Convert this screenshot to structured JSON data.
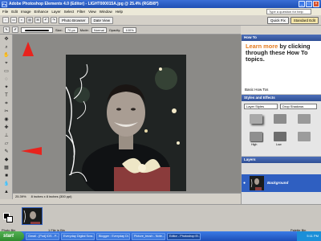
{
  "window": {
    "title": "Adobe Photoshop Elements 4.0 (Editor) - LIGHT000015A.jpg @ 25.4% (RGB/8*)",
    "app_icon_label": "Ps"
  },
  "menubar": {
    "items": [
      "File",
      "Edit",
      "Image",
      "Enhance",
      "Layer",
      "Select",
      "Filter",
      "View",
      "Window",
      "Help"
    ],
    "help_search_placeholder": "Type a question for help"
  },
  "shortcuts": {
    "photo_browser": "Photo Browser",
    "date_view": "Date View",
    "quick_fix": "Quick Fix",
    "standard_edit": "Standard Edit"
  },
  "options": {
    "size_label": "Size:",
    "size_value": "70 px",
    "mode_label": "Mode:",
    "mode_value": "Normal",
    "opacity_label": "Opacity:",
    "opacity_value": "100%"
  },
  "document": {
    "zoom": "25.39%",
    "dimensions": "8 inches x 8 inches (300 ppi)"
  },
  "panels": {
    "howto": {
      "title": "How To",
      "learn_prefix": "Learn more",
      "learn_rest": " by clicking through these How To topics.",
      "basic": "Basic How Tos"
    },
    "styles": {
      "title": "Styles and Effects",
      "category": "Layer Styles",
      "subcategory": "Drop Shadows",
      "swatch_labels": [
        "High",
        "Low"
      ]
    },
    "layers": {
      "title": "Layers",
      "layer_name": "Background"
    }
  },
  "photobin": {
    "label": "Photo Bin",
    "counter": "1 File in Bin",
    "palette_bin": "Palette Bin"
  },
  "taskbar": {
    "start": "start",
    "tasks": [
      "Gmail - [Pod] IDS - P...",
      "Everyday Digital Scra...",
      "Blogger : Everyday Di...",
      "Picture_brush - Note...",
      "Editor - Photoshop El..."
    ],
    "clock": "5:11 PM"
  },
  "colors": {
    "title_blue": "#1f4fb3",
    "layer_select": "#2f5fc1",
    "howto_accent": "#e47a1d",
    "arrow_red": "#e8231d"
  }
}
